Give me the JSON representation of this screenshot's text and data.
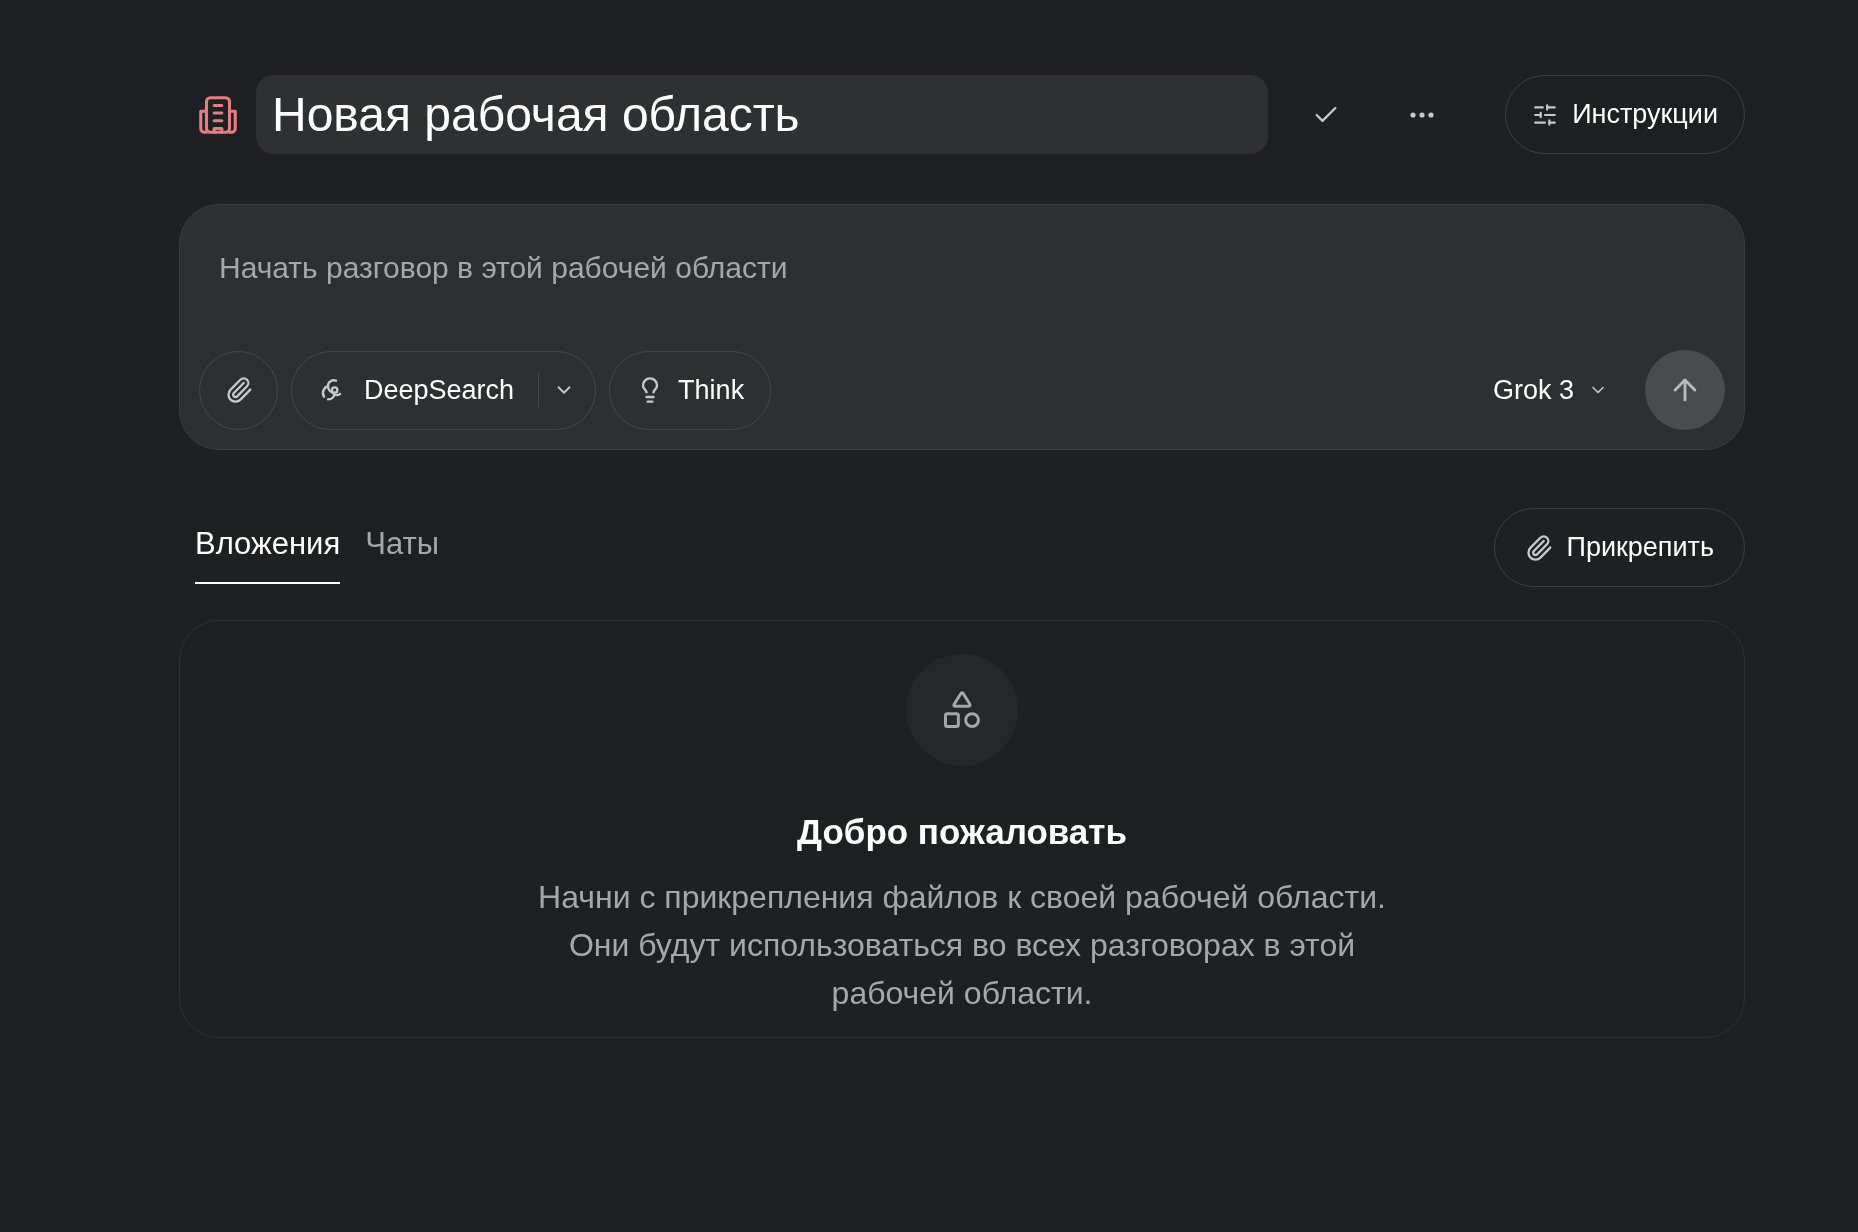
{
  "header": {
    "title": "Новая рабочая область",
    "instructions_button": "Инструкции"
  },
  "composer": {
    "placeholder": "Начать разговор в этой рабочей области",
    "deepsearch_button": "DeepSearch",
    "think_button": "Think",
    "think_on": false,
    "model": "Grok 3"
  },
  "tabs": [
    {
      "label": "Вложения",
      "selected": true
    },
    {
      "label": "Чаты",
      "selected": false
    }
  ],
  "attach_button": "Прикрепить",
  "empty_state": {
    "title": "Добро пожаловать",
    "message": "Начни с прикрепления файлов к своей рабочей области. Они будут использоваться во всех разговорах в этой рабочей области."
  }
}
